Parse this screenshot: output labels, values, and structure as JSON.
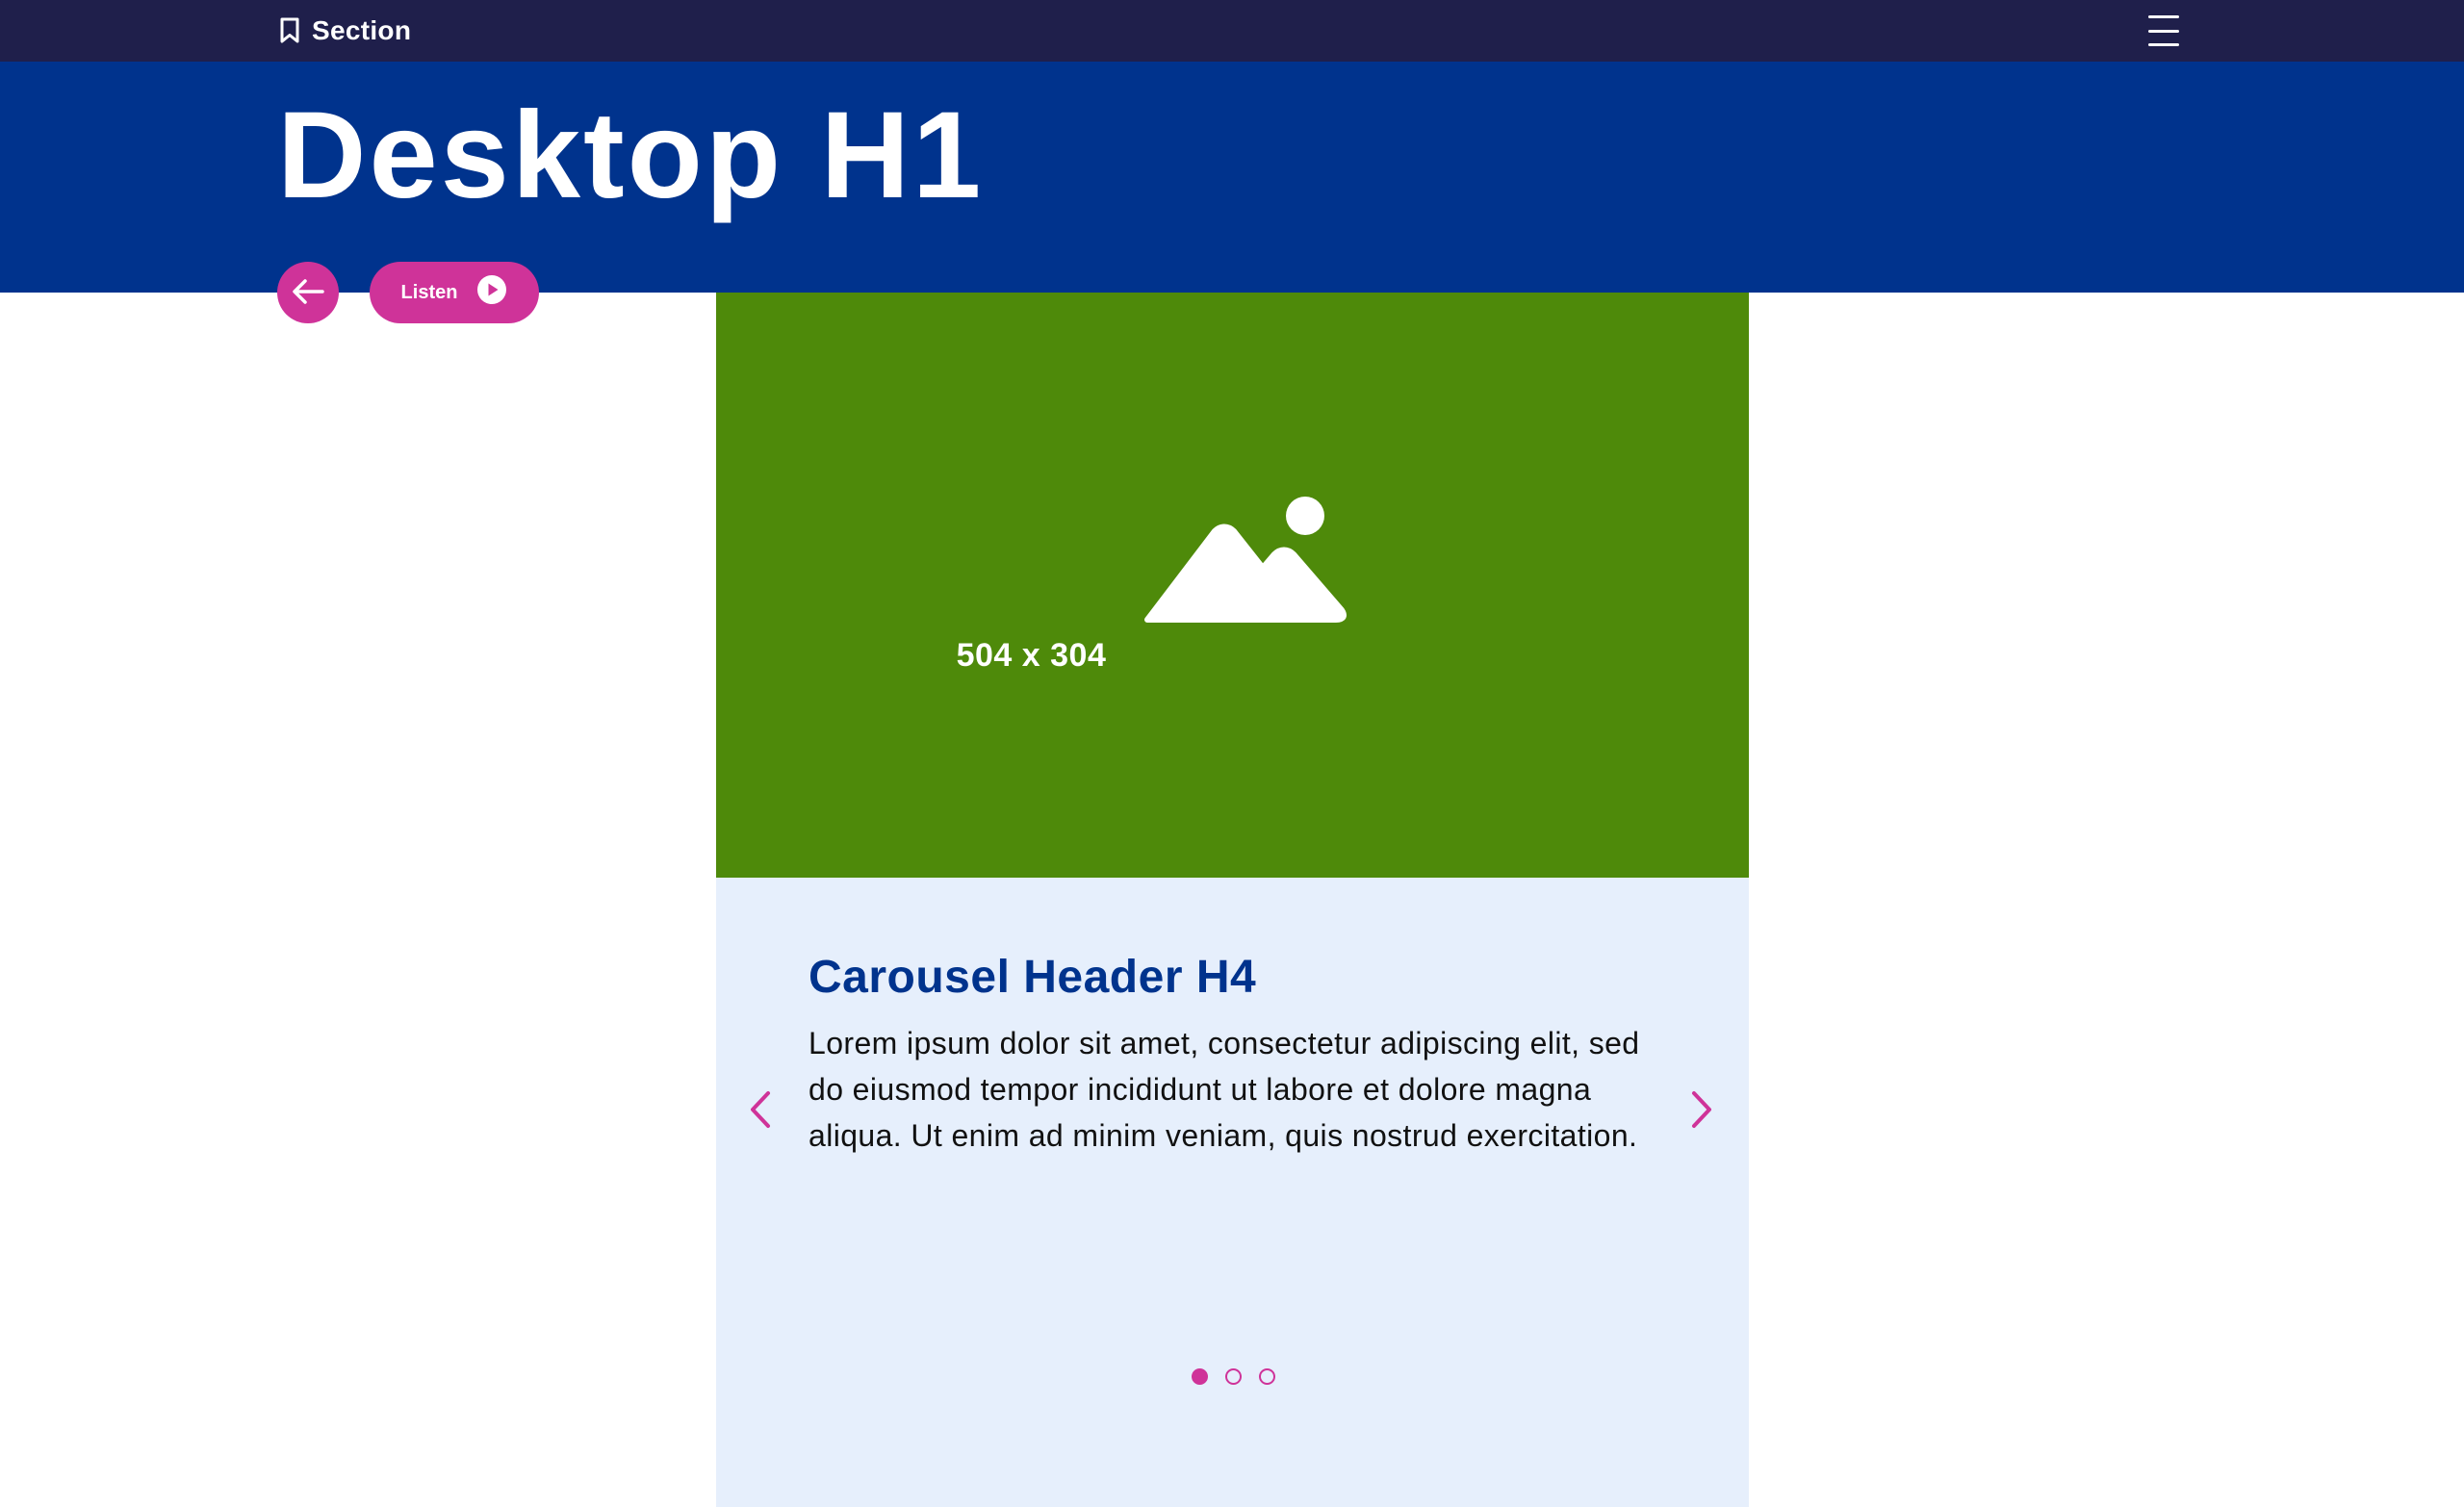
{
  "topbar": {
    "section_label": "Section",
    "section_icon": "bookmark-icon",
    "menu_icon": "hamburger-menu-icon"
  },
  "hero": {
    "title": "Desktop H1"
  },
  "actions": {
    "back_icon": "arrow-left-icon",
    "listen_label": "Listen",
    "listen_icon": "play-circle-icon"
  },
  "media": {
    "placeholder_icon": "image-placeholder-icon",
    "caption": "504 x 304"
  },
  "carousel": {
    "title": "Carousel Header H4",
    "body": "Lorem ipsum dolor sit amet, consectetur adipiscing elit, sed do eiusmod tempor incididunt ut labore et dolore magna aliqua. Ut enim ad minim veniam, quis nostrud exercitation.",
    "prev_icon": "chevron-left-icon",
    "next_icon": "chevron-right-icon",
    "slide_count": 3,
    "active_slide": 1
  },
  "colors": {
    "topbar_bg": "#1f1f4b",
    "hero_bg": "#00338d",
    "accent": "#cf3399",
    "media_bg": "#4e8a0a",
    "card_bg": "#e6effc",
    "card_title": "#00338d"
  }
}
